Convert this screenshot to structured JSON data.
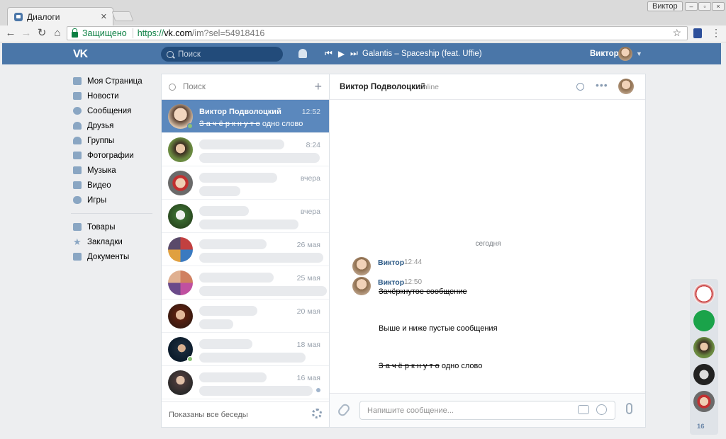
{
  "browser": {
    "tab_title": "Диалоги",
    "tab_close": "✕",
    "window_user": "Виктор",
    "security_label": "Защищено",
    "url_proto": "https://",
    "url_host": "vk.com",
    "url_path": "/im?sel=54918416"
  },
  "header": {
    "logo": "VK",
    "search_placeholder": "Поиск",
    "track": "Galantis – Spaceship (feat. Uffie)",
    "user_name": "Виктор"
  },
  "left_menu": {
    "items": [
      "Моя Страница",
      "Новости",
      "Сообщения",
      "Друзья",
      "Группы",
      "Фотографии",
      "Музыка",
      "Видео",
      "Игры"
    ],
    "secondary": [
      "Товары",
      "Закладки",
      "Документы"
    ]
  },
  "dialogs": {
    "search_placeholder": "Поиск",
    "active": {
      "name": "Виктор Подволоцкий",
      "time": "12:52",
      "msg_struck": "З а ч ё р к н у т о",
      "msg_rest": " одно слово"
    },
    "times": [
      "8:24",
      "вчера",
      "вчера",
      "26 мая",
      "25 мая",
      "20 мая",
      "18 мая",
      "16 мая"
    ],
    "footer": "Показаны все беседы"
  },
  "chat": {
    "name": "Виктор Подволоцкий",
    "status": "online",
    "date_divider": "сегодня",
    "msg1": {
      "author": "Виктор",
      "time": "12:44"
    },
    "msg2": {
      "author": "Виктор",
      "time": "12:50",
      "text": "Зачёркнутое сообщение"
    },
    "text_middle": "Выше и ниже пустые сообщения",
    "text_last_struck": "З а ч ё р к н у т о",
    "text_last_rest": " одно слово",
    "input_placeholder": "Напишите сообщение..."
  },
  "rail": {
    "count": "16"
  },
  "colors": {
    "vk_blue": "#4a76a8",
    "active_row": "#5b88bd",
    "link": "#2a5885"
  }
}
